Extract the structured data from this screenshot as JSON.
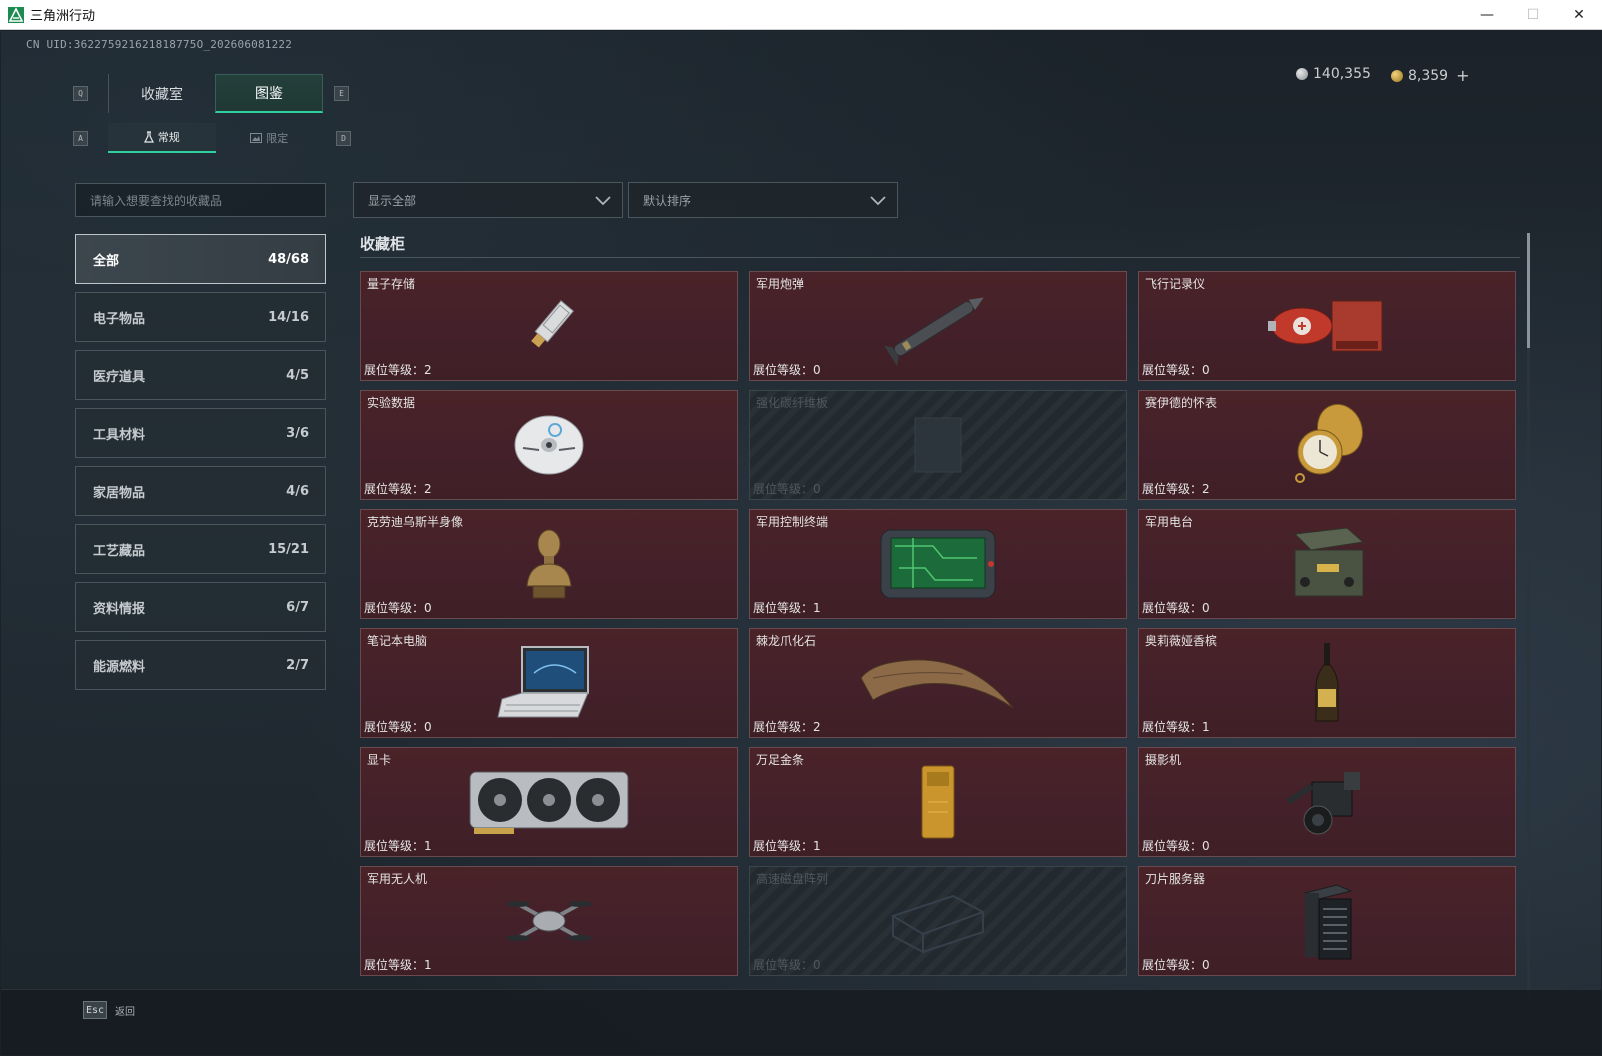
{
  "window": {
    "title": "三角洲行动"
  },
  "uid": "CN UID:362275921621818775O_202606081222",
  "currency": {
    "silver": "140,355",
    "gold": "8,359",
    "plus": "+"
  },
  "keys": {
    "q": "Q",
    "e": "E",
    "a": "A",
    "d": "D"
  },
  "tabs": [
    {
      "label": "收藏室"
    },
    {
      "label": "图鉴"
    }
  ],
  "subtabs": [
    {
      "label": "常规"
    },
    {
      "label": "限定"
    }
  ],
  "search": {
    "placeholder": "请输入想要查找的收藏品"
  },
  "filter": {
    "value": "显示全部"
  },
  "sort": {
    "value": "默认排序"
  },
  "categories": [
    {
      "label": "全部",
      "count": "48/68"
    },
    {
      "label": "电子物品",
      "count": "14/16"
    },
    {
      "label": "医疗道具",
      "count": "4/5"
    },
    {
      "label": "工具材料",
      "count": "3/6"
    },
    {
      "label": "家居物品",
      "count": "4/6"
    },
    {
      "label": "工艺藏品",
      "count": "15/21"
    },
    {
      "label": "资料情报",
      "count": "6/7"
    },
    {
      "label": "能源燃料",
      "count": "2/7"
    }
  ],
  "section": {
    "title": "收藏柜"
  },
  "items": [
    {
      "name": "量子存储",
      "level": "展位等级：2"
    },
    {
      "name": "军用炮弹",
      "level": "展位等级：0"
    },
    {
      "name": "飞行记录仪",
      "level": "展位等级：0"
    },
    {
      "name": "实验数据",
      "level": "展位等级：2"
    },
    {
      "name": "强化碳纤维板",
      "level": "展位等级：0"
    },
    {
      "name": "赛伊德的怀表",
      "level": "展位等级：2"
    },
    {
      "name": "克劳迪乌斯半身像",
      "level": "展位等级：0"
    },
    {
      "name": "军用控制终端",
      "level": "展位等级：1"
    },
    {
      "name": "军用电台",
      "level": "展位等级：0"
    },
    {
      "name": "笔记本电脑",
      "level": "展位等级：0"
    },
    {
      "name": "棘龙爪化石",
      "level": "展位等级：2"
    },
    {
      "name": "奥莉薇娅香槟",
      "level": "展位等级：1"
    },
    {
      "name": "显卡",
      "level": "展位等级：1"
    },
    {
      "name": "万足金条",
      "level": "展位等级：1"
    },
    {
      "name": "摄影机",
      "level": "展位等级：0"
    },
    {
      "name": "军用无人机",
      "level": "展位等级：1"
    },
    {
      "name": "高速磁盘阵列",
      "level": "展位等级：0"
    },
    {
      "name": "刀片服务器",
      "level": "展位等级：0"
    }
  ],
  "footer": {
    "esc": "Esc",
    "back": "返回"
  },
  "colors": {
    "accent": "#2fd0a0",
    "card_bg": "#4a2328",
    "locked_bg": "#222a30"
  }
}
